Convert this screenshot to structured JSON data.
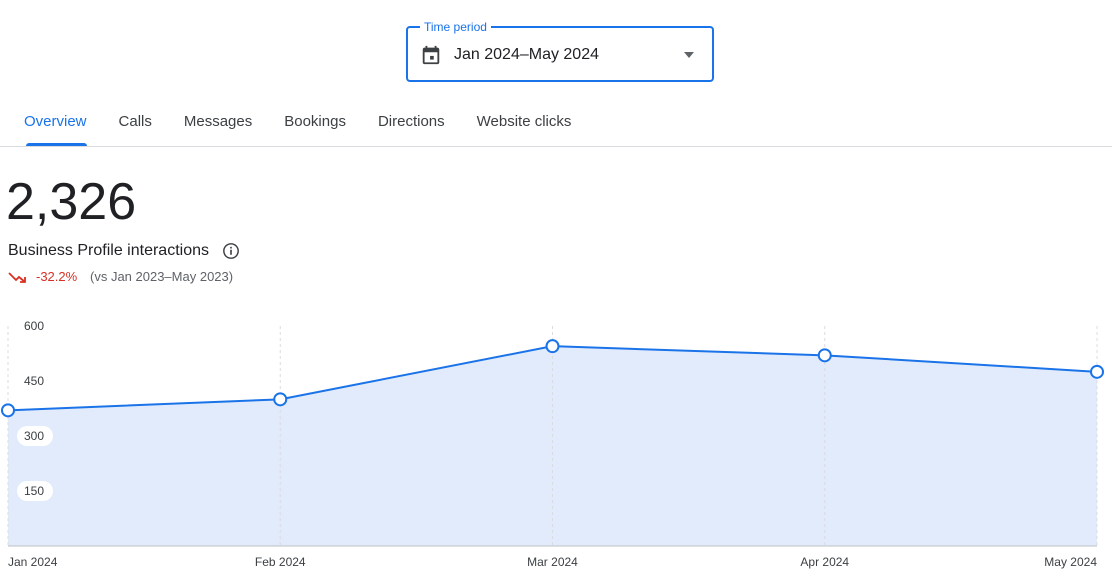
{
  "time_period": {
    "label": "Time period",
    "value": "Jan 2024–May 2024",
    "icon": "calendar-icon"
  },
  "tabs": [
    {
      "label": "Overview",
      "active": true
    },
    {
      "label": "Calls",
      "active": false
    },
    {
      "label": "Messages",
      "active": false
    },
    {
      "label": "Bookings",
      "active": false
    },
    {
      "label": "Directions",
      "active": false
    },
    {
      "label": "Website clicks",
      "active": false
    }
  ],
  "summary": {
    "total": "2,326",
    "metric_label": "Business Profile interactions",
    "change": "-32.2%",
    "comparison": "(vs Jan 2023–May 2023)",
    "change_color": "#d93025"
  },
  "colors": {
    "accent": "#1a73e8",
    "area_fill": "#e1ebfb"
  },
  "chart_data": {
    "type": "area",
    "x": [
      "Jan 2024",
      "Feb 2024",
      "Mar 2024",
      "Apr 2024",
      "May 2024"
    ],
    "series": [
      {
        "values": [
          370,
          400,
          545,
          520,
          475
        ]
      }
    ],
    "ylim": [
      0,
      600
    ],
    "yticks": [
      150,
      300,
      450,
      600
    ],
    "grid": "vertical-dashed",
    "legend": "none"
  }
}
